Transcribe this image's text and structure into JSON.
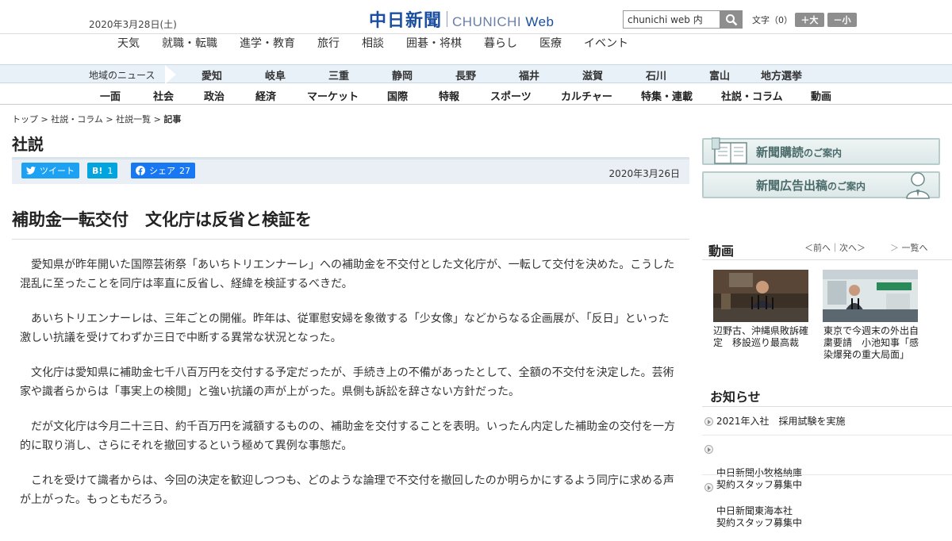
{
  "header": {
    "date": "2020年3月28日(土)",
    "logo_ja": "中日新聞",
    "logo_en": "CHUNICHI",
    "logo_web": "Web",
    "search_value": "chunichi web 内",
    "fontsize_label": "文字（0）",
    "font_up": "＋大",
    "font_down": "－小"
  },
  "category_nav": [
    "天気",
    "就職・転職",
    "進学・教育",
    "旅行",
    "相談",
    "囲碁・将棋",
    "暮らし",
    "医療",
    "イベント"
  ],
  "region_nav": {
    "label": "地域のニュース",
    "items": [
      "愛知",
      "岐阜",
      "三重",
      "静岡",
      "長野",
      "福井",
      "滋賀",
      "石川",
      "富山",
      "地方選挙"
    ]
  },
  "section_nav": [
    "一面",
    "社会",
    "政治",
    "経済",
    "マーケット",
    "国際",
    "特報",
    "スポーツ",
    "カルチャー",
    "特集・連載",
    "社説・コラム",
    "動画"
  ],
  "breadcrumb": {
    "items": [
      "トップ",
      "社説・コラム",
      "社説一覧"
    ],
    "current": "記事",
    "sep": " > "
  },
  "page_title": "社説",
  "share": {
    "tweet": "ツイート",
    "hatena": "B!",
    "hatena_count": "1",
    "facebook": "シェア",
    "facebook_count": "27",
    "article_date": "2020年3月26日"
  },
  "article": {
    "headline": "補助金一転交付　文化庁は反省と検証を",
    "paragraphs": [
      "愛知県が昨年開いた国際芸術祭「あいちトリエンナーレ」への補助金を不交付とした文化庁が、一転して交付を決めた。こうした混乱に至ったことを同庁は率直に反省し、経緯を検証するべきだ。",
      "あいちトリエンナーレは、三年ごとの開催。昨年は、従軍慰安婦を象徴する「少女像」などからなる企画展が、「反日」といった激しい抗議を受けてわずか三日で中断する異常な状況となった。",
      "文化庁は愛知県に補助金七千八百万円を交付する予定だったが、手続き上の不備があったとして、全額の不交付を決定した。芸術家や識者らからは「事実上の検閲」と強い抗議の声が上がった。県側も訴訟を辞さない方針だった。",
      "だが文化庁は今月二十三日、約千百万円を減額するものの、補助金を交付することを表明。いったん内定した補助金の交付を一方的に取り消し、さらにそれを撤回するという極めて異例な事態だ。",
      "これを受けて識者からは、今回の決定を歓迎しつつも、どのような論理で不交付を撤回したのか明らかにするよう同庁に求める声が上がった。もっともだろう。"
    ]
  },
  "sidebar": {
    "banner1_main": "新聞購読",
    "banner1_sub": "のご案内",
    "banner2_main": "新聞広告出稿",
    "banner2_sub": "のご案内",
    "video_title": "動画",
    "video_nav": "＜前へ｜次へ＞",
    "video_list": "一覧へ",
    "videos": [
      {
        "caption": "辺野古、沖縄県敗訴確定　移設巡り最高裁"
      },
      {
        "caption": "東京で今週末の外出自粛要請　小池知事「感染爆発の重大局面」"
      }
    ],
    "notice_title": "お知らせ",
    "notices": [
      "2021年入社　採用試験を実施",
      "中日新聞小牧格納庫\n契約スタッフ募集中",
      "中日新聞東海本社\n契約スタッフ募集中"
    ]
  },
  "colors": {
    "brand": "#1a4fa0",
    "twitter": "#1da1f2",
    "hatena": "#00a4de",
    "facebook": "#1877f2"
  }
}
